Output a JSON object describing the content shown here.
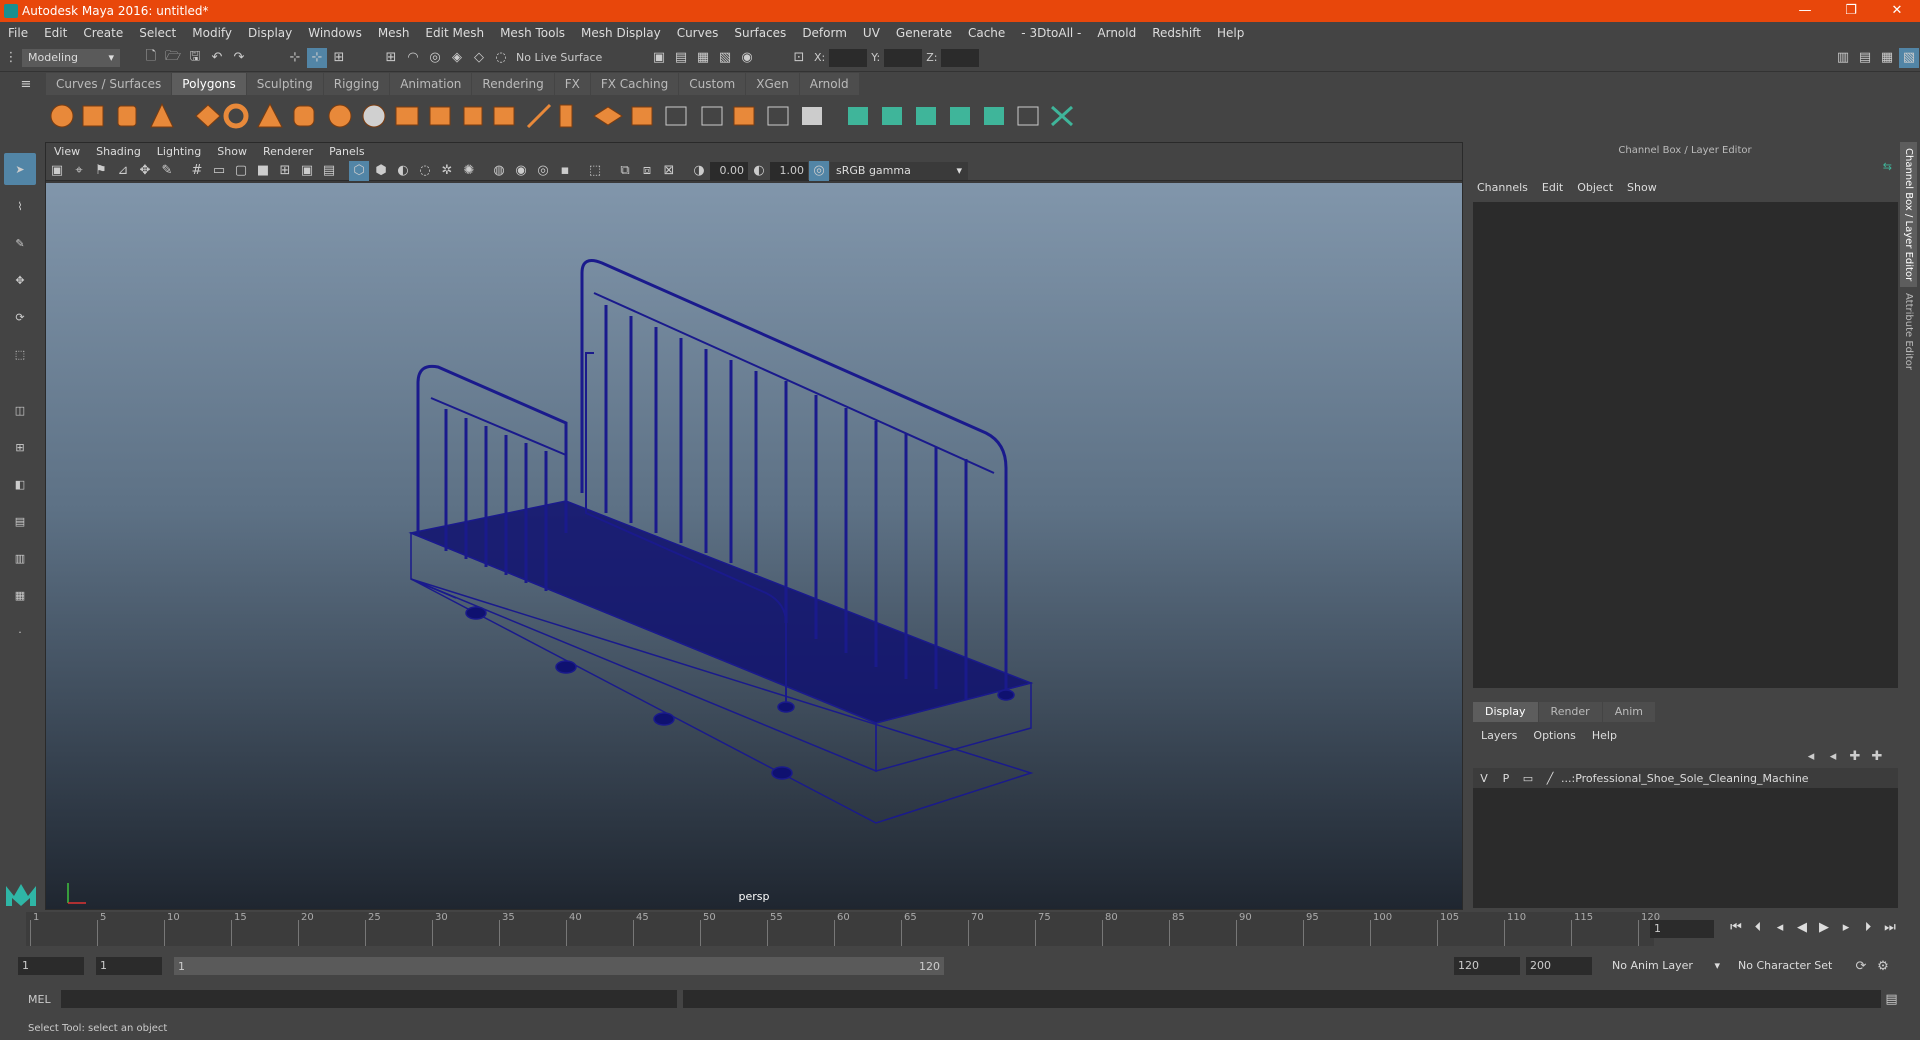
{
  "window": {
    "title": "Autodesk Maya 2016: untitled*",
    "minimize": "—",
    "restore": "❐",
    "close": "✕"
  },
  "menubar": [
    "File",
    "Edit",
    "Create",
    "Select",
    "Modify",
    "Display",
    "Windows",
    "Mesh",
    "Edit Mesh",
    "Mesh Tools",
    "Mesh Display",
    "Curves",
    "Surfaces",
    "Deform",
    "UV",
    "Generate",
    "Cache",
    "- 3DtoAll -",
    "Arnold",
    "Redshift",
    "Help"
  ],
  "statusline": {
    "mode": "Modeling",
    "live_surface": "No Live Surface",
    "x_label": "X:",
    "y_label": "Y:",
    "z_label": "Z:"
  },
  "shelf_tabs": [
    {
      "label": "Curves / Surfaces",
      "active": false
    },
    {
      "label": "Polygons",
      "active": true
    },
    {
      "label": "Sculpting",
      "active": false
    },
    {
      "label": "Rigging",
      "active": false
    },
    {
      "label": "Animation",
      "active": false
    },
    {
      "label": "Rendering",
      "active": false
    },
    {
      "label": "FX",
      "active": false
    },
    {
      "label": "FX Caching",
      "active": false
    },
    {
      "label": "Custom",
      "active": false
    },
    {
      "label": "XGen",
      "active": false
    },
    {
      "label": "Arnold",
      "active": false
    }
  ],
  "viewport": {
    "menu": [
      "View",
      "Shading",
      "Lighting",
      "Show",
      "Renderer",
      "Panels"
    ],
    "exposure": "0.00",
    "gamma": "1.00",
    "color_space": "sRGB gamma",
    "camera": "persp"
  },
  "channel_box": {
    "header": "Channel Box / Layer Editor",
    "menu": [
      "Channels",
      "Edit",
      "Object",
      "Show"
    ]
  },
  "layer_editor": {
    "tabs": [
      {
        "label": "Display",
        "active": true
      },
      {
        "label": "Render",
        "active": false
      },
      {
        "label": "Anim",
        "active": false
      }
    ],
    "menu": [
      "Layers",
      "Options",
      "Help"
    ],
    "layers": [
      {
        "v": "V",
        "p": "P",
        "name": "...:Professional_Shoe_Sole_Cleaning_Machine"
      }
    ]
  },
  "side_tabs": [
    "Channel Box / Layer Editor",
    "Attribute Editor"
  ],
  "timeline": {
    "ticks": [
      "1",
      "5",
      "10",
      "15",
      "20",
      "25",
      "30",
      "35",
      "40",
      "45",
      "50",
      "55",
      "60",
      "65",
      "70",
      "75",
      "80",
      "85",
      "90",
      "95",
      "100",
      "105",
      "110",
      "115",
      "120"
    ],
    "current_frame": "1"
  },
  "range": {
    "start": "1",
    "anim_start": "1",
    "range_start": "1",
    "range_end": "120",
    "anim_end": "120",
    "end": "200",
    "anim_layer": "No Anim Layer",
    "character_set": "No Character Set"
  },
  "command": {
    "label": "MEL",
    "help": "Select Tool: select an object"
  },
  "colors": {
    "titlebar": "#e8470b",
    "wire": "#1a1a8c",
    "active_tool": "#5285a6"
  }
}
